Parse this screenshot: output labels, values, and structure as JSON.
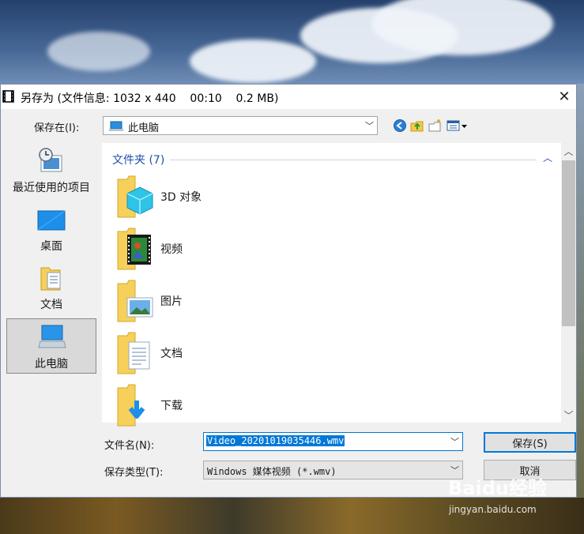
{
  "dialog": {
    "title": "另存为 (文件信息: 1032 x 440    00:10    0.2 MB)",
    "close_glyph": "✕"
  },
  "toolbar": {
    "save_in_label": "保存在(I):",
    "location_value": "此电脑",
    "icons": [
      "back-icon",
      "up-folder-icon",
      "new-folder-icon",
      "view-menu-icon"
    ]
  },
  "places": [
    {
      "label": "最近使用的项目",
      "icon": "recent-items-icon",
      "selected": false
    },
    {
      "label": "桌面",
      "icon": "desktop-icon",
      "selected": false
    },
    {
      "label": "文档",
      "icon": "documents-icon",
      "selected": false
    },
    {
      "label": "此电脑",
      "icon": "this-pc-icon",
      "selected": true
    }
  ],
  "filelist": {
    "group_header": "文件夹 (7)",
    "items": [
      {
        "label": "3D 对象",
        "icon": "3d-objects-folder-icon"
      },
      {
        "label": "视频",
        "icon": "videos-folder-icon"
      },
      {
        "label": "图片",
        "icon": "pictures-folder-icon"
      },
      {
        "label": "文档",
        "icon": "documents-folder-icon"
      },
      {
        "label": "下载",
        "icon": "downloads-folder-icon"
      }
    ]
  },
  "form": {
    "filename_label": "文件名(N):",
    "filename_value": "Video_20201019035446.wmv",
    "filetype_label": "保存类型(T):",
    "filetype_value": "Windows 媒体视频 (*.wmv)",
    "save_button": "保存(S)",
    "cancel_button": "取消"
  },
  "watermark": {
    "brand": "Baidu经验",
    "url": "jingyan.baidu.com"
  },
  "colors": {
    "accent": "#0078d7",
    "group_header": "#1e4fa8",
    "folder": "#f6d05a"
  }
}
